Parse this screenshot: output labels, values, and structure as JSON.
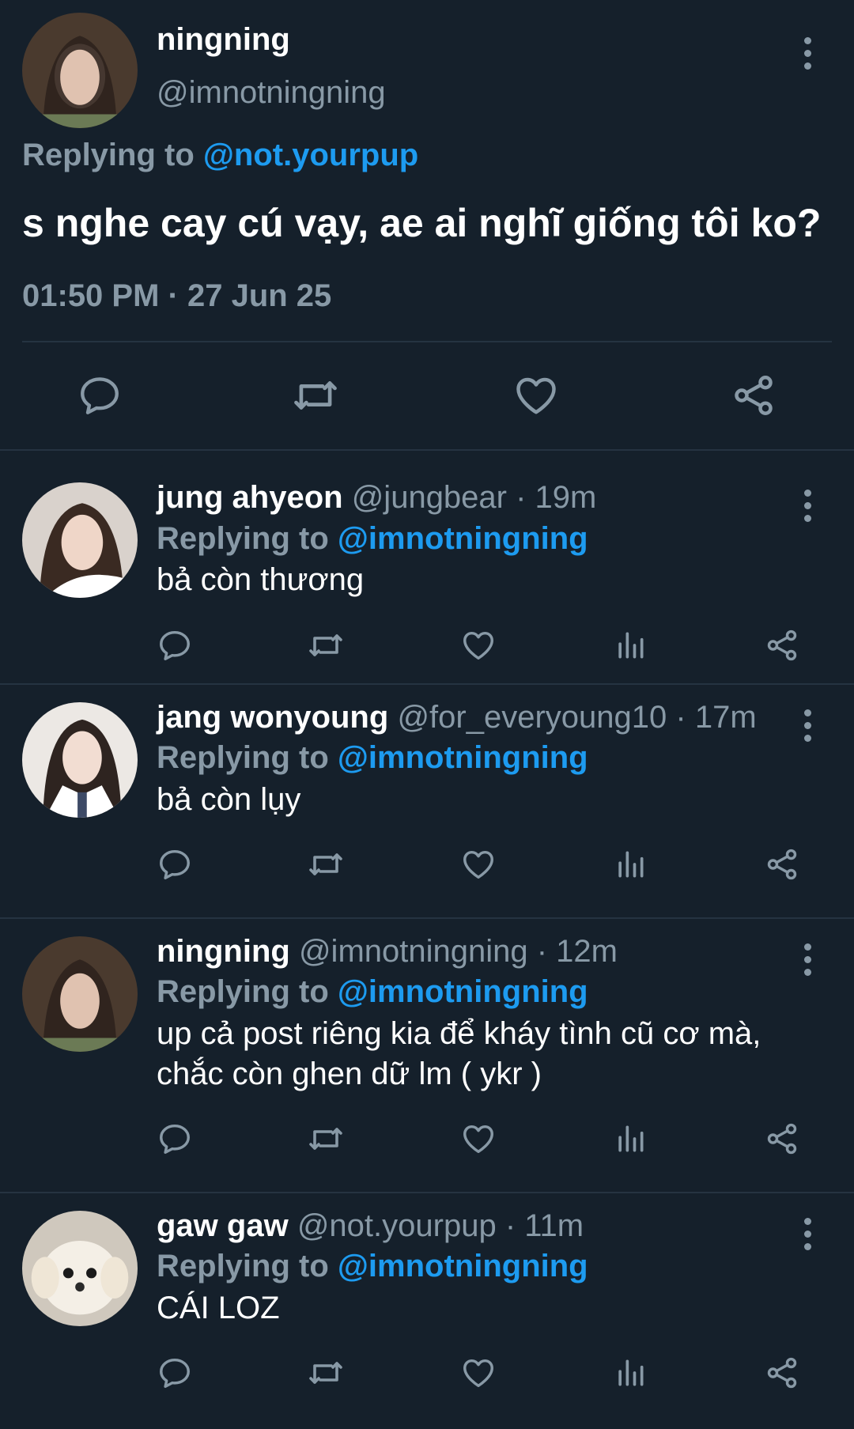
{
  "colors": {
    "background": "#15202b",
    "divider": "#253341",
    "muted": "#8899a6",
    "accent": "#1d9bf0",
    "text": "#ffffff"
  },
  "main_tweet": {
    "name": "ningning",
    "handle": "@imnotningning",
    "replying_label": "Replying to",
    "replying_to": "@not.yourpup",
    "text": "s nghe cay cú vạy, ae ai nghĩ giống tôi ko?",
    "timestamp": "01:50 PM · 27 Jun 25",
    "actions": [
      "reply-icon",
      "retweet-icon",
      "like-icon",
      "share-icon"
    ]
  },
  "replies": [
    {
      "name": "jung ahyeon",
      "handle": "@jungbear",
      "time": "· 19m",
      "replying_label": "Replying to",
      "replying_to": "@imnotningning",
      "text": "bả còn thương",
      "avatar": "photo-avatar"
    },
    {
      "name": "jang wonyoung",
      "handle": "@for_everyoung10",
      "time": "· 17m",
      "replying_label": "Replying to",
      "replying_to": "@imnotningning",
      "text": "bả còn lụy",
      "avatar": "photo-avatar"
    },
    {
      "name": "ningning",
      "handle": "@imnotningning",
      "time": "· 12m",
      "replying_label": "Replying to",
      "replying_to": "@imnotningning",
      "text": "up cả post riêng kia để kháy tình cũ cơ mà, chắc còn ghen dữ lm ( ykr )",
      "avatar": "photo-avatar"
    },
    {
      "name": "gaw gaw",
      "handle": "@not.yourpup",
      "time": "· 11m",
      "replying_label": "Replying to",
      "replying_to": "@imnotningning",
      "text": "CÁI LOZ",
      "avatar": "dog-avatar"
    }
  ],
  "reply_actions": [
    "reply-icon",
    "retweet-icon",
    "like-icon",
    "analytics-icon",
    "share-icon"
  ]
}
